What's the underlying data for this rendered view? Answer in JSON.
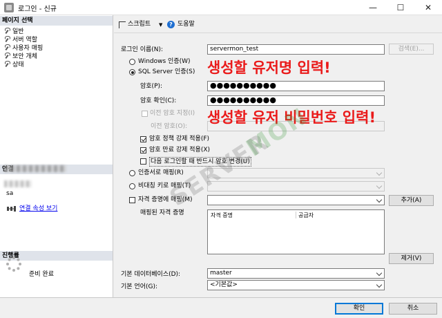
{
  "window": {
    "title": "로그인 - 신규",
    "minimize": "—",
    "maximize": "☐",
    "close": "✕"
  },
  "left_panel": {
    "page_select_header": "페이지 선택",
    "pages": [
      {
        "label": "일반"
      },
      {
        "label": "서버 역할"
      },
      {
        "label": "사용자 매핑"
      },
      {
        "label": "보안 개체"
      },
      {
        "label": "상태"
      }
    ],
    "connection_header": "연결",
    "connection_user": "sa",
    "connection_link": "연결 속성 보기",
    "progress_header": "진행률",
    "progress_status": "준비 완료"
  },
  "toolbar": {
    "script_label": "스크립트",
    "help_label": "도움말"
  },
  "form": {
    "login_name_label": "로그인 이름(N):",
    "login_name_value": "servermon_test",
    "search_button": "검색(E)...",
    "windows_auth": "Windows 인증(W)",
    "sql_auth": "SQL Server 인증(S)",
    "password_label": "암호(P):",
    "password_value": "●●●●●●●●●●",
    "confirm_label": "암호 확인(C):",
    "confirm_value": "●●●●●●●●●●",
    "specify_old": "이전 암호 지정(I)",
    "old_password_label": "이전 암호(O):",
    "enforce_policy": "암호 정책 강제 적용(F)",
    "enforce_expiration": "암호 만료 강제 적용(X)",
    "must_change": "다음 로그인할 때 반드시 암호 변경(U)",
    "cert_mapped": "인증서로 매핑(R)",
    "asym_key_mapped": "비대칭 키로 매핑(T)",
    "map_credential": "자격 증명에 매핑(M)",
    "add_button": "추가(A)",
    "mapped_credentials_label": "매핑된 자격 증명",
    "cred_col_credential": "자격 증명",
    "cred_col_provider": "공급자",
    "remove_button": "제거(V)",
    "default_db_label": "기본 데이터베이스(D):",
    "default_db_value": "master",
    "default_lang_label": "기본 언어(G):",
    "default_lang_value": "<기본값>"
  },
  "annotations": {
    "username_note": "생성할 유저명 입력!",
    "password_note": "생성할 유저 비밀번호 입력!"
  },
  "watermark": {
    "part1": "SERVER",
    "part2": "MON"
  },
  "footer": {
    "ok_button": "확인",
    "cancel_button": "취소"
  },
  "colors": {
    "annotation": "#ea1a1a",
    "link": "#0000ee",
    "header_bg": "#dfe3ea"
  }
}
